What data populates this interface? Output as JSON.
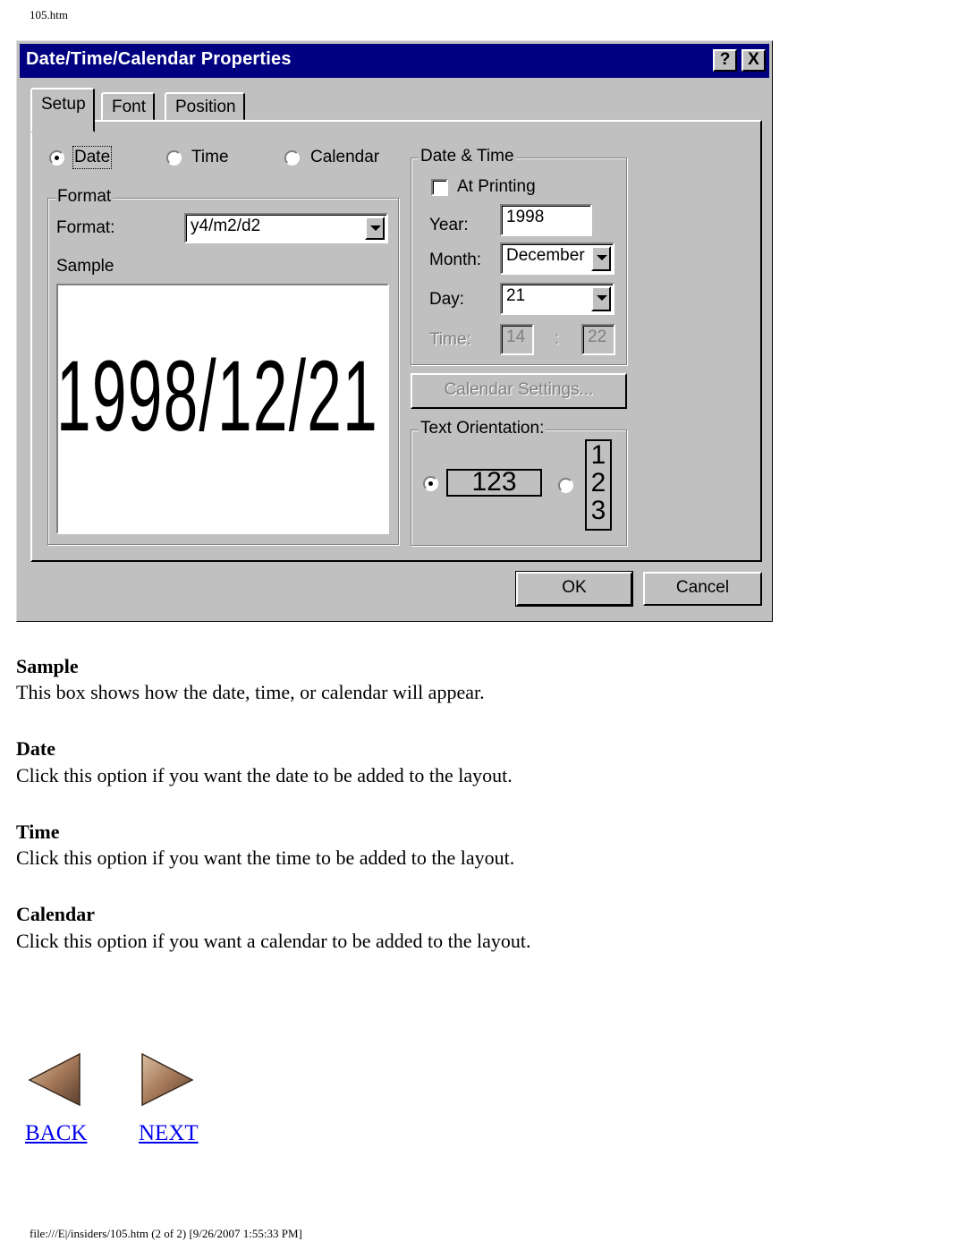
{
  "page": {
    "header": "105.htm",
    "footer": "file:///E|/insiders/105.htm (2 of 2) [9/26/2007 1:55:33 PM]"
  },
  "dialog": {
    "title": "Date/Time/Calendar Properties",
    "help_button": "?",
    "close_button": "X",
    "tabs": [
      {
        "label": "Setup",
        "active": true
      },
      {
        "label": "Font",
        "active": false
      },
      {
        "label": "Position",
        "active": false
      }
    ],
    "type_options": [
      {
        "label": "Date",
        "selected": true
      },
      {
        "label": "Time",
        "selected": false
      },
      {
        "label": "Calendar",
        "selected": false
      }
    ],
    "format_group": {
      "label": "Format",
      "format_label": "Format:",
      "format_value": "y4/m2/d2",
      "sample_label": "Sample",
      "sample_value": "1998/12/21"
    },
    "datetime_group": {
      "label": "Date & Time",
      "at_printing_label": "At Printing",
      "at_printing_checked": false,
      "year_label": "Year:",
      "year_value": "1998",
      "month_label": "Month:",
      "month_value": "December",
      "day_label": "Day:",
      "day_value": "21",
      "time_label": "Time:",
      "time_hour": "14",
      "time_separator": ":",
      "time_minute": "22"
    },
    "calendar_settings_button": "Calendar Settings...",
    "orientation_group": {
      "label": "Text Orientation:",
      "horizontal_sample": "123",
      "vertical_sample": [
        "1",
        "2",
        "3"
      ],
      "selected": "horizontal"
    },
    "ok_button": "OK",
    "cancel_button": "Cancel"
  },
  "doc": {
    "sections": [
      {
        "heading": "Sample",
        "text": "This box shows how the date, time, or calendar will appear."
      },
      {
        "heading": "Date",
        "text": "Click this option if you want the date to be added to the layout."
      },
      {
        "heading": "Time",
        "text": "Click this option if you want the time to be added to the layout."
      },
      {
        "heading": "Calendar",
        "text": "Click this option if you want a calendar to be added to the layout."
      }
    ]
  },
  "nav": {
    "back_label": "BACK",
    "next_label": "NEXT",
    "link_color": "#0000ee"
  }
}
